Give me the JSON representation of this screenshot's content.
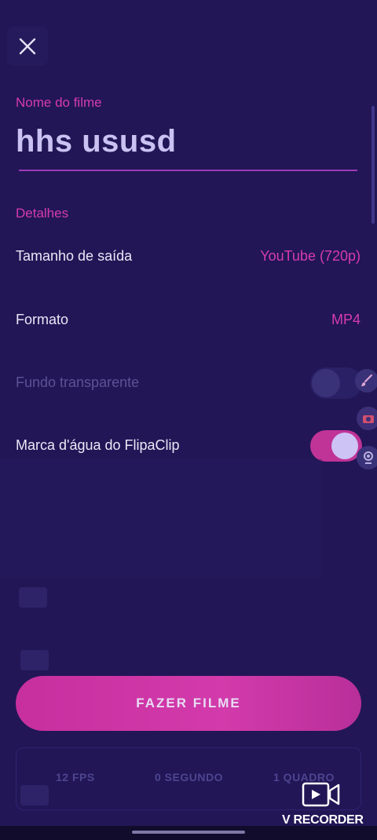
{
  "header": {
    "close_icon": "close-icon"
  },
  "film": {
    "name_label": "Nome do filme",
    "name_value": "hhs ususd"
  },
  "details": {
    "label": "Detalhes",
    "output_size_label": "Tamanho de saída",
    "output_size_value": "YouTube (720p)",
    "format_label": "Formato",
    "format_value": "MP4",
    "transparent_bg_label": "Fundo transparente",
    "transparent_bg_enabled": false,
    "watermark_label": "Marca d'água do FlipaClip",
    "watermark_enabled": true
  },
  "actions": {
    "make_movie_label": "FAZER FILME"
  },
  "stats": {
    "fps": "12 FPS",
    "duration": "0 SEGUNDO",
    "frames": "1 QUADRO"
  },
  "overlay": {
    "recorder_label": "V RECORDER"
  },
  "colors": {
    "background": "#221656",
    "accent": "#d63bb0",
    "title_text": "#c9c2f2",
    "toggle_on": "#c03397"
  }
}
